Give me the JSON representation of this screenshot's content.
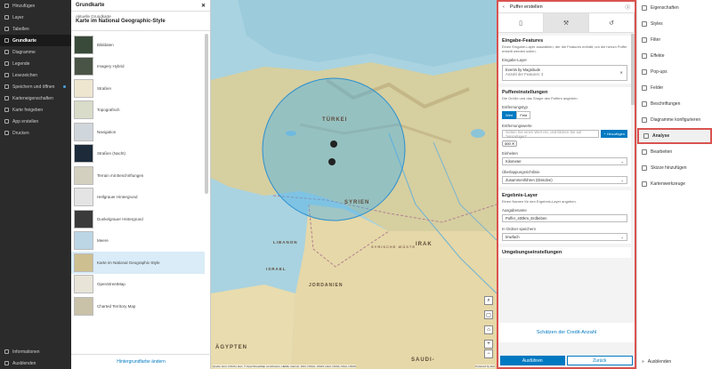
{
  "left_nav": {
    "items": [
      {
        "label": "Hinzufügen",
        "icon": "plus-icon"
      },
      {
        "label": "Layer",
        "icon": "layers-icon"
      },
      {
        "label": "Tabellen",
        "icon": "table-icon"
      },
      {
        "label": "Grundkarte",
        "icon": "basemap-icon"
      },
      {
        "label": "Diagramme",
        "icon": "chart-icon"
      },
      {
        "label": "Legende",
        "icon": "legend-icon"
      },
      {
        "label": "Lesezeichen",
        "icon": "bookmark-icon"
      },
      {
        "label": "Speichern und öffnen",
        "icon": "save-icon"
      },
      {
        "label": "Karteneigenschaften",
        "icon": "map-properties-icon"
      },
      {
        "label": "Karte freigeben",
        "icon": "share-icon"
      },
      {
        "label": "App erstellen",
        "icon": "app-icon"
      },
      {
        "label": "Drucken",
        "icon": "print-icon"
      }
    ],
    "bottom": [
      {
        "label": "Informationen",
        "icon": "info-icon"
      },
      {
        "label": "Ausblenden",
        "icon": "collapse-icon"
      }
    ]
  },
  "gallery": {
    "title": "Grundkarte",
    "current_label": "Aktuelle Grundkarte",
    "current_value": "Karte im National Geographic-Style",
    "items": [
      "Bilddaten",
      "Imagery Hybrid",
      "Straßen",
      "Topografisch",
      "Navigation",
      "Straßen (Nacht)",
      "Terrain mit Beschriftungen",
      "Hellgrauer Hintergrund",
      "Dunkelgrauer Hintergrund",
      "Meere",
      "Karte im National Geographic-Style",
      "OpenStreetMap",
      "Charted Territory Map"
    ],
    "footer_link": "Hintergrundfarbe ändern"
  },
  "map": {
    "labels": [
      "TÜRKEI",
      "SYRIEN",
      "IRAK",
      "LIBANON",
      "ISRAEL",
      "JORDANIEN",
      "ÄGYPTEN",
      "SAUDI-",
      "SYRISCHE WÜSTE"
    ],
    "attribution": "Quelle: Esri, USGS | Esri, © OpenStreetMap contributors, HERE, Garmin, FAO, NOAA, USGS | Esri, NASA, NGA, USGS",
    "powered": "Powered by Esri"
  },
  "buffer_panel": {
    "title": "Puffer erstellen",
    "input_section": {
      "title": "Eingabe-Features",
      "desc": "Einen Eingabe-Layer auswählen, der die Features enthält, um die herum Puffer erstellt werden sollen.",
      "layer_label": "Eingabe-Layer",
      "layer_name": "Events by Magnitude",
      "layer_count": "Anzahl der Features: 3"
    },
    "settings_section": {
      "title": "Puffereinstellungen",
      "desc": "Die Größe und das Shape des Puffers angeben.",
      "distance_type_label": "Entfernungstyp",
      "distance_type_options": [
        "Wert",
        "Feld"
      ],
      "distance_values_label": "Entfernungswerte",
      "distance_placeholder": "Geben Sie einen Wert ein, und klicken Sie auf \"Hinzufügen\"",
      "add_button": "+ Hinzufügen",
      "chip": "400",
      "unit_label": "Einheiten",
      "unit_value": "Kilometer",
      "overlap_label": "Überlappungsrichtlinie",
      "overlap_value": "Zusammenführen (Dissolve)"
    },
    "result_section": {
      "title": "Ergebnis-Layer",
      "desc": "Einen Namen für den Ergebnis-Layer angeben.",
      "name_label": "Ausgabename",
      "name_value": "Puffer_400km_Erdbeben",
      "folder_label": "In Ordner speichern",
      "folder_value": "tmwfach"
    },
    "env_section_title": "Umgebungseinstellungen",
    "credits_link": "Schätzen der Credit-Anzahl",
    "run_button": "Ausführen",
    "back_button": "Zurück"
  },
  "right_nav": {
    "items": [
      {
        "label": "Eigenschaften",
        "icon": "properties-icon"
      },
      {
        "label": "Styles",
        "icon": "styles-icon"
      },
      {
        "label": "Filter",
        "icon": "filter-icon"
      },
      {
        "label": "Effekte",
        "icon": "effects-icon"
      },
      {
        "label": "Pop-ups",
        "icon": "popup-icon"
      },
      {
        "label": "Felder",
        "icon": "fields-icon"
      },
      {
        "label": "Beschriftungen",
        "icon": "labels-icon"
      },
      {
        "label": "Diagramme konfigurieren",
        "icon": "chart-config-icon"
      },
      {
        "label": "Analyse",
        "icon": "analysis-icon"
      },
      {
        "label": "Bearbeiten",
        "icon": "edit-icon"
      },
      {
        "label": "Skizze hinzufügen",
        "icon": "sketch-icon"
      },
      {
        "label": "Kartenwerkzeuge",
        "icon": "map-tools-icon"
      }
    ],
    "bottom": "Ausblenden"
  },
  "colors": {
    "accent": "#0079c1",
    "highlight": "#d9534f",
    "buffer": "#4ab0e8"
  }
}
